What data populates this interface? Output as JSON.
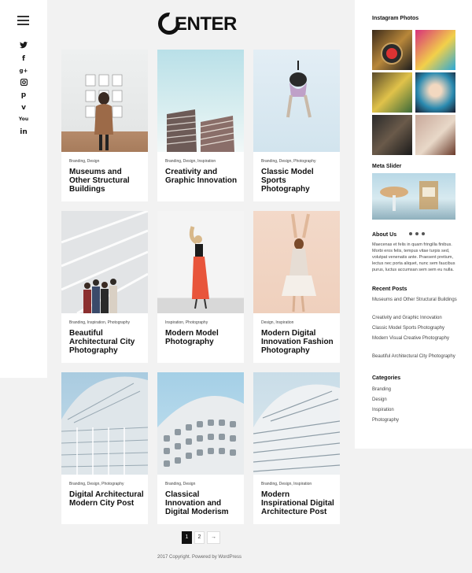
{
  "logo": {
    "text": "ENTER"
  },
  "social_icons": [
    "twitter-icon",
    "facebook-icon",
    "google-plus-icon",
    "instagram-icon",
    "pinterest-icon",
    "vimeo-icon",
    "youtube-icon",
    "linkedin-icon"
  ],
  "posts": [
    {
      "cats": "Branding, Design",
      "title": "Museums and Other Structural Buildings"
    },
    {
      "cats": "Branding, Design, Inspiration",
      "title": "Creativity and Graphic Innovation"
    },
    {
      "cats": "Branding, Design, Photography",
      "title": "Classic Model Sports Photography"
    },
    {
      "cats": "Branding, Inspiration, Photography",
      "title": "Beautiful Architectural City Photography"
    },
    {
      "cats": "Inspiration, Photography",
      "title": "Modern Model Photography"
    },
    {
      "cats": "Design, Inspiration",
      "title": "Modern Digital Innovation Fashion Photography"
    },
    {
      "cats": "Branding, Design, Photography",
      "title": "Digital Architectural Modern City Post"
    },
    {
      "cats": "Branding, Design",
      "title": "Classical Innovation and Digital Moderism"
    },
    {
      "cats": "Branding, Design, Inspiration",
      "title": "Modern Inspirational Digital Architecture Post"
    }
  ],
  "pagination": {
    "pages": [
      "1",
      "2"
    ],
    "next": "→",
    "current": "1"
  },
  "footer": "2017 Copyright. Powered by WordPress",
  "sidebar": {
    "instagram_title": "Instagram Photos",
    "meta_slider_title": "Meta Slider",
    "about_title": "About Us",
    "about_text": "Maecenas et felis in quam fringilla finibus. Morbi eros felis, tempus vitae turpis sed, volutpat venenatis ante. Praesent pretium, lectus nec porta aliquet, nunc sem faucibus purus, luctus accumsan sem sem eu nulla.",
    "recent_title": "Recent Posts",
    "recent": [
      "Museums and Other Structural Buildings",
      "Creativity and Graphic Innovation",
      "Classic Model Sports Photography",
      "Modern Visual Creative Photography",
      "Beautiful Architectural City Photography"
    ],
    "categories_title": "Categories",
    "categories": [
      "Branding",
      "Design",
      "Inspiration",
      "Photography"
    ]
  }
}
